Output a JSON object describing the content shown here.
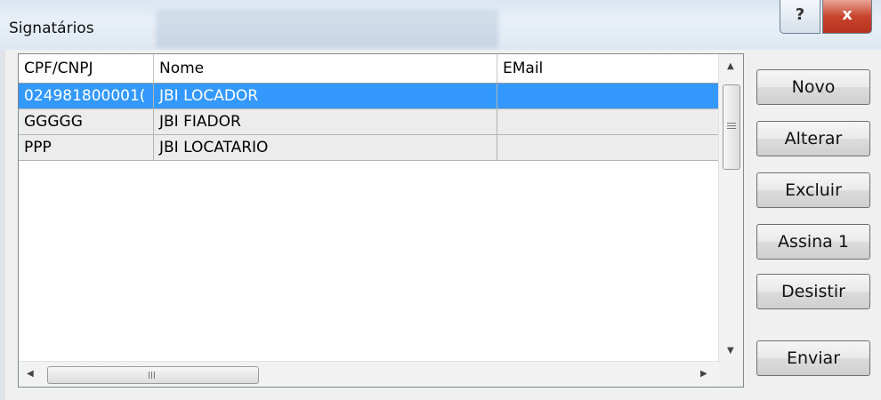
{
  "window": {
    "title": "Signatários",
    "help_label": "?",
    "close_label": "x"
  },
  "grid": {
    "columns": [
      "CPF/CNPJ",
      "Nome",
      "EMail"
    ],
    "rows": [
      {
        "cpf": "024981800001(",
        "nome": "JBI LOCADOR",
        "email": ""
      },
      {
        "cpf": "GGGGG",
        "nome": "JBI FIADOR",
        "email": ""
      },
      {
        "cpf": "PPP",
        "nome": "JBI LOCATARIO",
        "email": ""
      }
    ],
    "selected_row": 0
  },
  "scrollbar": {
    "up_arrow": "▲",
    "down_arrow": "▼",
    "left_arrow": "◀",
    "right_arrow": "▶"
  },
  "buttons": {
    "novo": "Novo",
    "alterar": "Alterar",
    "excluir": "Excluir",
    "assina": "Assina 1",
    "desistir": "Desistir",
    "enviar": "Enviar"
  },
  "colors": {
    "selection": "#3399ff",
    "close_button": "#c8442d"
  }
}
